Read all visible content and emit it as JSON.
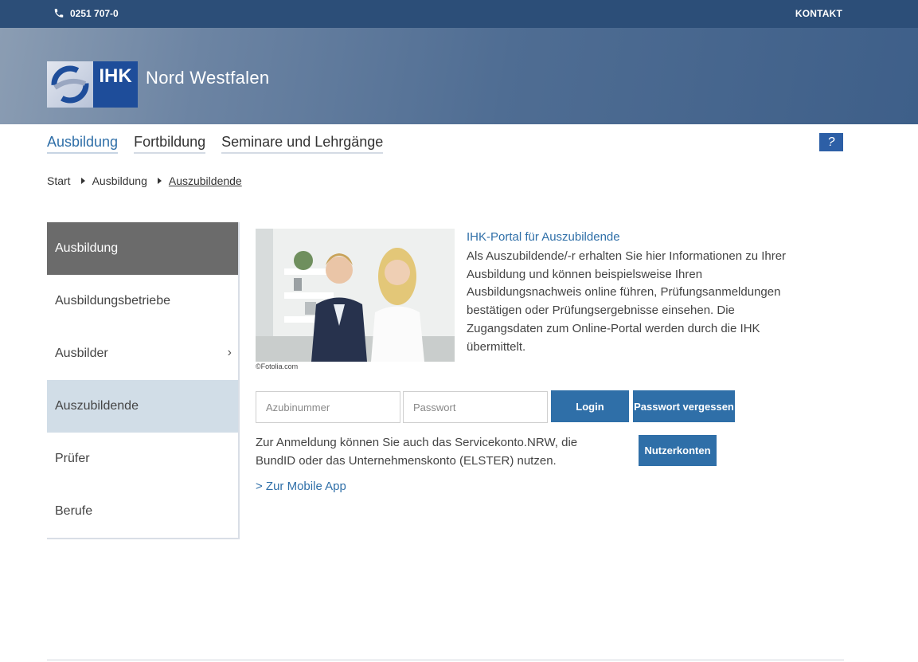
{
  "topbar": {
    "phone": "0251 707-0",
    "contact": "KONTAKT"
  },
  "header": {
    "logo_text": "IHK",
    "title": "Nord Westfalen"
  },
  "main_nav": [
    {
      "label": "Ausbildung",
      "active": true
    },
    {
      "label": "Fortbildung"
    },
    {
      "label": "Seminare und Lehrgänge"
    }
  ],
  "help_label": "?",
  "breadcrumb": [
    "Start",
    "Ausbildung",
    "Auszubildende"
  ],
  "sidebar": {
    "items": [
      {
        "label": "Ausbildung"
      },
      {
        "label": "Ausbildungsbetriebe"
      },
      {
        "label": "Ausbilder",
        "has_children": true
      },
      {
        "label": "Auszubildende",
        "selected": true
      },
      {
        "label": "Prüfer"
      },
      {
        "label": "Berufe"
      }
    ],
    "chevron": "›"
  },
  "content": {
    "image_credit": "©Fotolia.com",
    "portal_title": "IHK-Portal für Auszubildende",
    "portal_text": "Als Auszubildende/-r erhalten Sie hier Informationen zu Ihrer Ausbildung und können beispielsweise Ihren Ausbildungsnachweis online führen, Prüfungsanmeldungen bestätigen oder Prüfungsergebnisse einsehen. Die Zugangsdaten zum Online-Portal werden durch die IHK übermittelt.",
    "login": {
      "username_placeholder": "Azubinummer",
      "username_value": "",
      "password_placeholder": "Passwort",
      "password_value": "",
      "login_button": "Login",
      "forgot_button": "Passwort vergessen"
    },
    "alt_login_text": "Zur Anmeldung können Sie auch das Servicekonto.NRW, die BundID oder das Unternehmenskonto (ELSTER) nutzen.",
    "user_accounts_button": "Nutzerkonten",
    "mobile_link": "> Zur Mobile App"
  },
  "colors": {
    "topbar": "#2c4e78",
    "accent": "#2f6fa8",
    "sidebar_header": "#6b6b6b",
    "sidebar_selected": "#d1dde7",
    "logo_blue": "#1e4d9a"
  }
}
